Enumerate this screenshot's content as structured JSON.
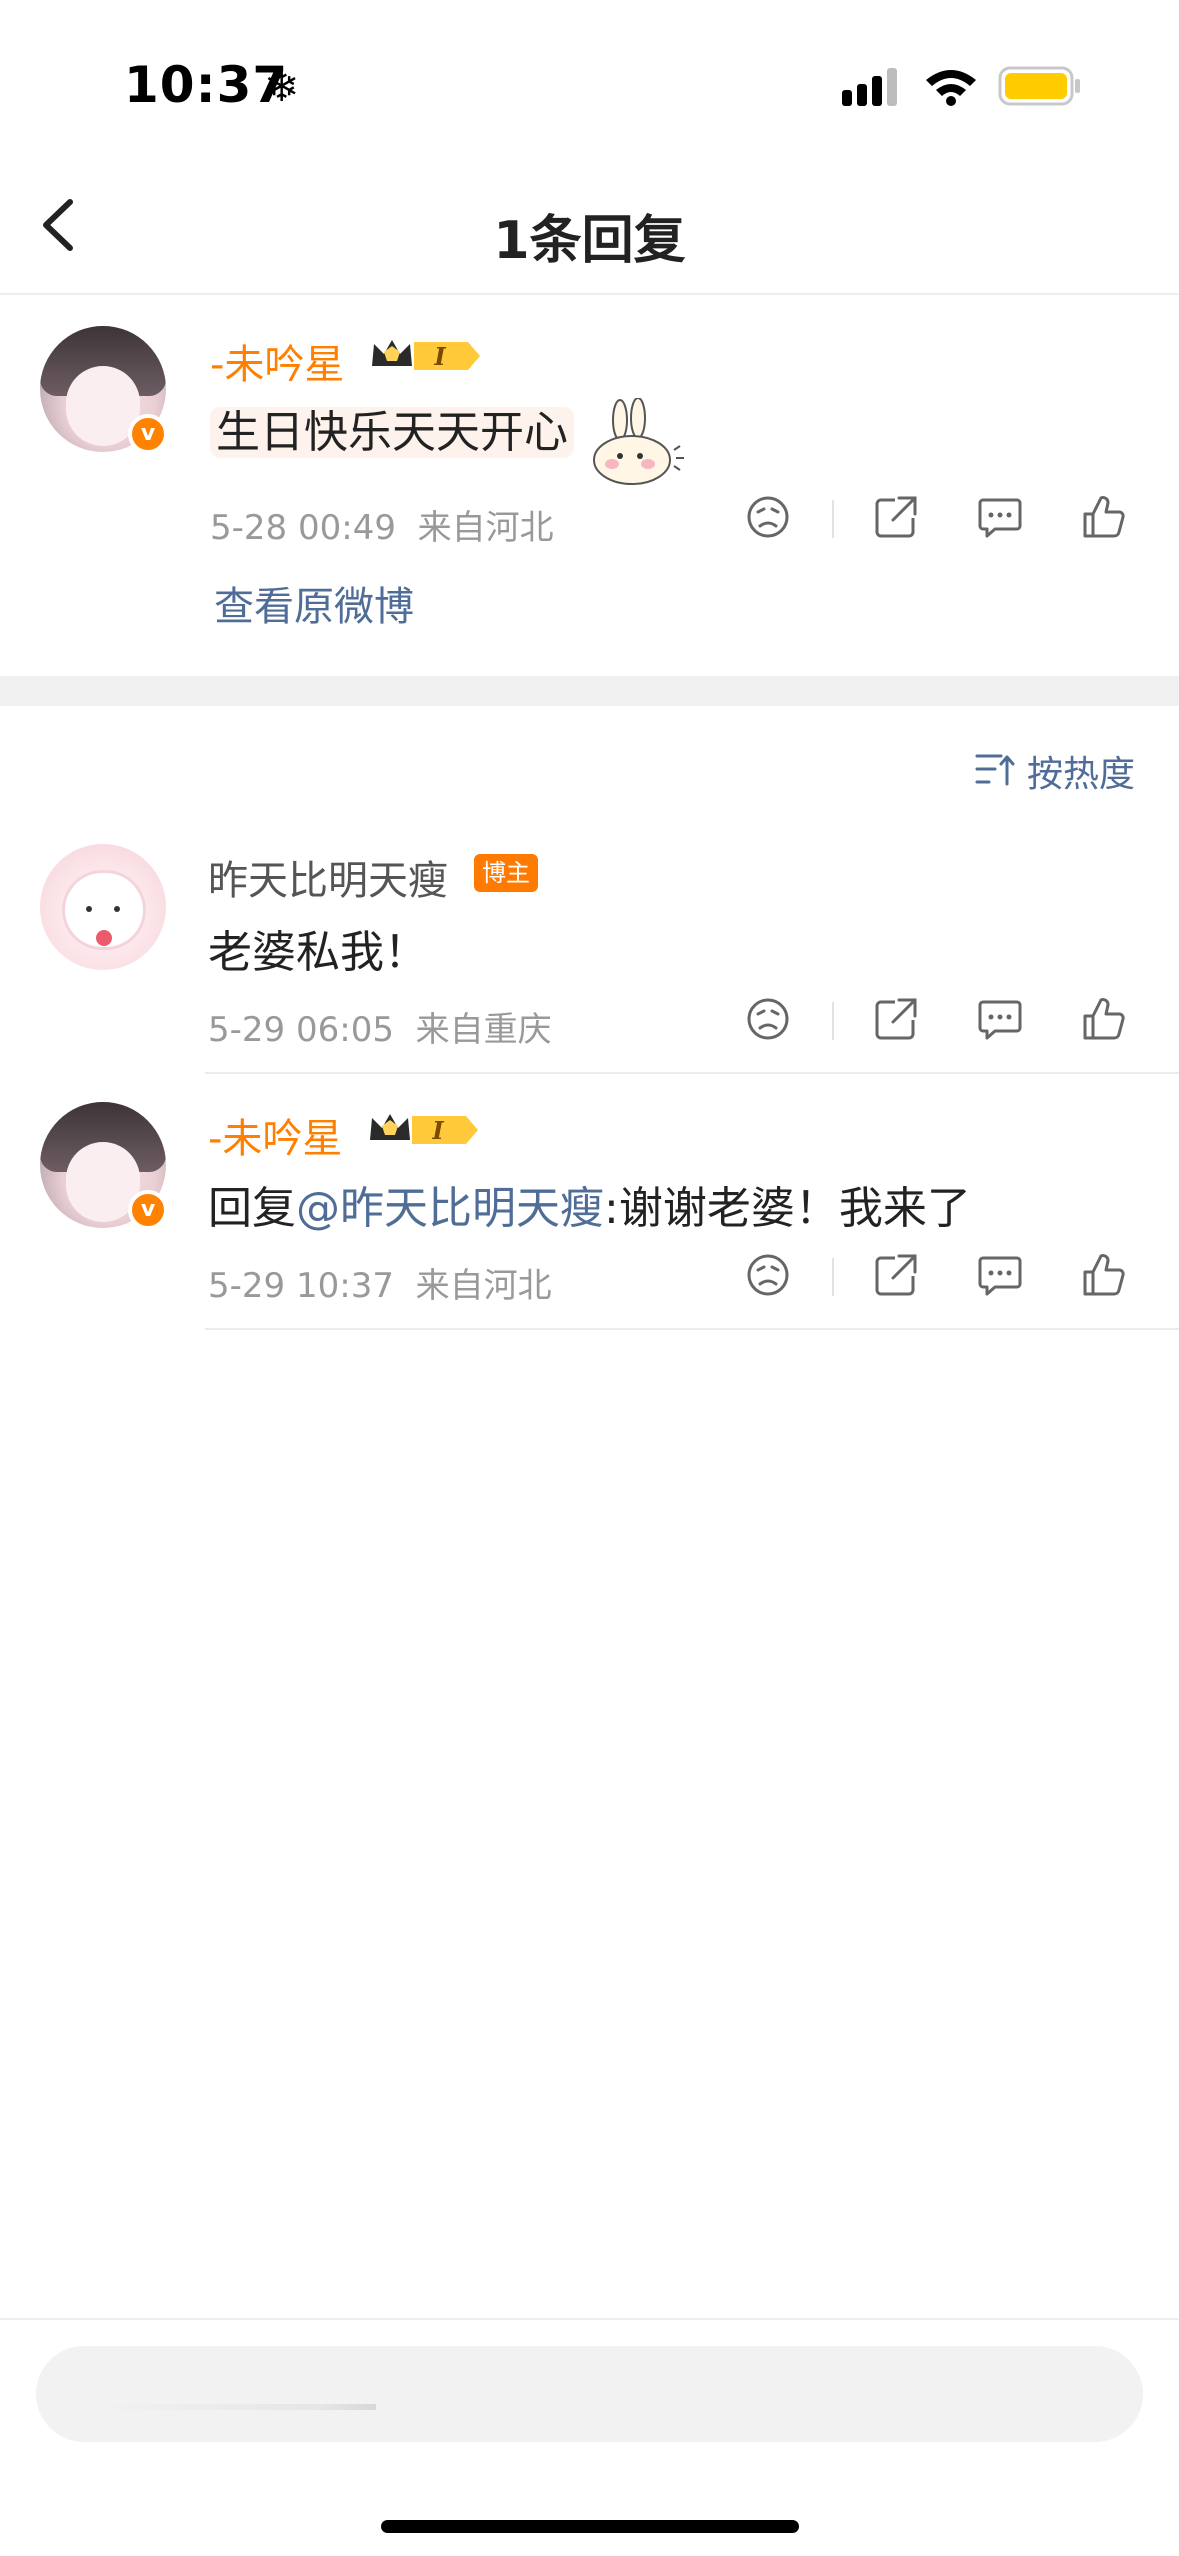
{
  "status_bar": {
    "time": "10:37",
    "snow_glyph": "❄",
    "battery_color": "#ffcc00"
  },
  "nav": {
    "title": "1条回复",
    "back_icon": "chevron-left-icon"
  },
  "root_comment": {
    "username": "-未吟星",
    "level": "I",
    "text": "生日快乐天天开心",
    "timestamp": "5-28 00:49",
    "location": "来自河北",
    "view_original": "查看原微博"
  },
  "sort": {
    "label": "按热度"
  },
  "replies": [
    {
      "username": "昨天比明天瘦",
      "badge": "博主",
      "text": "老婆私我！",
      "timestamp": "5-29 06:05",
      "location": "来自重庆"
    },
    {
      "username": "-未吟星",
      "level": "I",
      "reply_prefix": "回复",
      "mention": "@昨天比明天瘦",
      "text": ":谢谢老婆！我来了",
      "timestamp": "5-29 10:37",
      "location": "来自河北"
    }
  ],
  "colors": {
    "accent_orange": "#ff7f00",
    "link_blue": "#4f6d96",
    "meta_gray": "#999999"
  }
}
